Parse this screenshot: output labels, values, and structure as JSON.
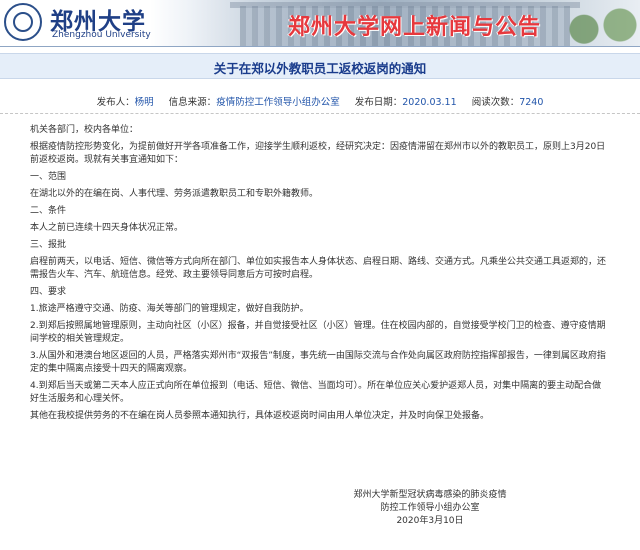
{
  "header": {
    "brand_cn": "郑州大学",
    "brand_en": "Zhengzhou University",
    "banner_title": "郑州大学网上新闻与公告"
  },
  "article": {
    "title": "关于在郑以外教职员工返校返岗的通知",
    "meta": {
      "publisher_label": "发布人：",
      "publisher": "杨明",
      "source_label": "信息来源：",
      "source": "疫情防控工作领导小组办公室",
      "date_label": "发布日期：",
      "date": "2020.03.11",
      "views_label": "阅读次数：",
      "views": "7240"
    },
    "paragraphs": [
      "机关各部门，校内各单位：",
      "根据疫情防控形势变化，为提前做好开学各项准备工作，迎接学生顺利返校，经研究决定：因疫情滞留在郑州市以外的教职员工，原则上3月20日前返校返岗。现就有关事宜通知如下：",
      "一、范围",
      "在湖北以外的在编在岗、人事代理、劳务派遣教职员工和专职外籍教师。",
      "二、条件",
      "本人之前已连续十四天身体状况正常。",
      "三、报批",
      "启程前两天，以电话、短信、微信等方式向所在部门、单位如实报告本人身体状态、启程日期、路线、交通方式。凡乘坐公共交通工具返郑的，还需报告火车、汽车、航班信息。经党、政主要领导同意后方可按时启程。",
      "四、要求",
      "1.旅途严格遵守交通、防疫、海关等部门的管理规定，做好自我防护。",
      "2.到郑后按照属地管理原则，主动向社区（小区）报备，并自觉接受社区（小区）管理。住在校园内部的，自觉接受学校门卫的检查、遵守疫情期间学校的相关管理规定。",
      "3.从国外和港澳台地区返回的人员，严格落实郑州市“双报告”制度，事先统一由国际交流与合作处向属区政府防控指挥部报告，一律到属区政府指定的集中隔离点接受十四天的隔离观察。",
      "4.到郑后当天或第二天本人应正式向所在单位报到（电话、短信、微信、当面均可）。所在单位应关心爱护返郑人员，对集中隔离的要主动配合做好生活服务和心理关怀。",
      "其他在我校提供劳务的不在编在岗人员参照本通知执行，具体返校返岗时间由用人单位决定，并及时向保卫处报备。"
    ],
    "signature": {
      "line1": "郑州大学新型冠状病毒感染的肺炎疫情",
      "line2": "防控工作领导小组办公室",
      "date": "2020年3月10日"
    }
  }
}
